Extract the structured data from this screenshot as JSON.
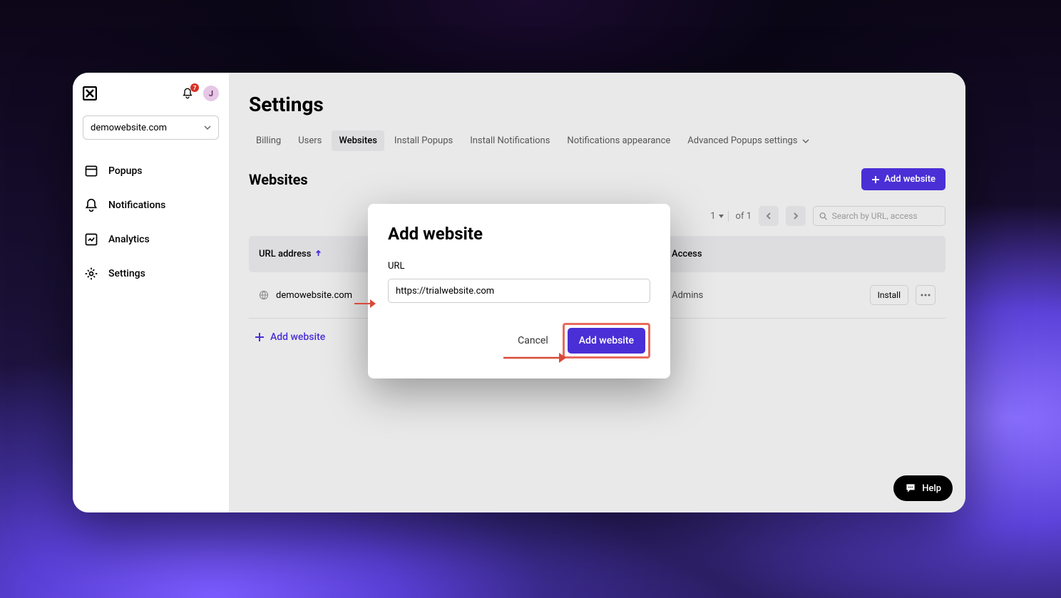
{
  "sidebar": {
    "site_selected": "demowebsite.com",
    "notification_count": "7",
    "avatar_initial": "J",
    "nav": [
      {
        "label": "Popups"
      },
      {
        "label": "Notifications"
      },
      {
        "label": "Analytics"
      },
      {
        "label": "Settings"
      }
    ]
  },
  "main": {
    "page_title": "Settings",
    "tabs": {
      "billing": "Billing",
      "users": "Users",
      "websites": "Websites",
      "install_popups": "Install Popups",
      "install_notifications": "Install Notifications",
      "notifications_appearance": "Notifications appearance",
      "advanced_popups": "Advanced Popups settings"
    },
    "section_title": "Websites",
    "add_website_button": "Add website",
    "pagination": {
      "current": "1",
      "of_label": "of 1"
    },
    "search_placeholder": "Search by URL, access",
    "table": {
      "col_url": "URL address",
      "col_access": "Access",
      "rows": [
        {
          "url": "demowebsite.com",
          "access": "Admins",
          "install_label": "Install"
        }
      ]
    },
    "add_website_link": "Add website"
  },
  "dialog": {
    "title": "Add website",
    "url_label": "URL",
    "url_value": "https://trialwebsite.com",
    "cancel_label": "Cancel",
    "submit_label": "Add website"
  },
  "help": {
    "label": "Help"
  },
  "colors": {
    "primary": "#4a2fd6",
    "danger_highlight": "#e86a5c"
  }
}
